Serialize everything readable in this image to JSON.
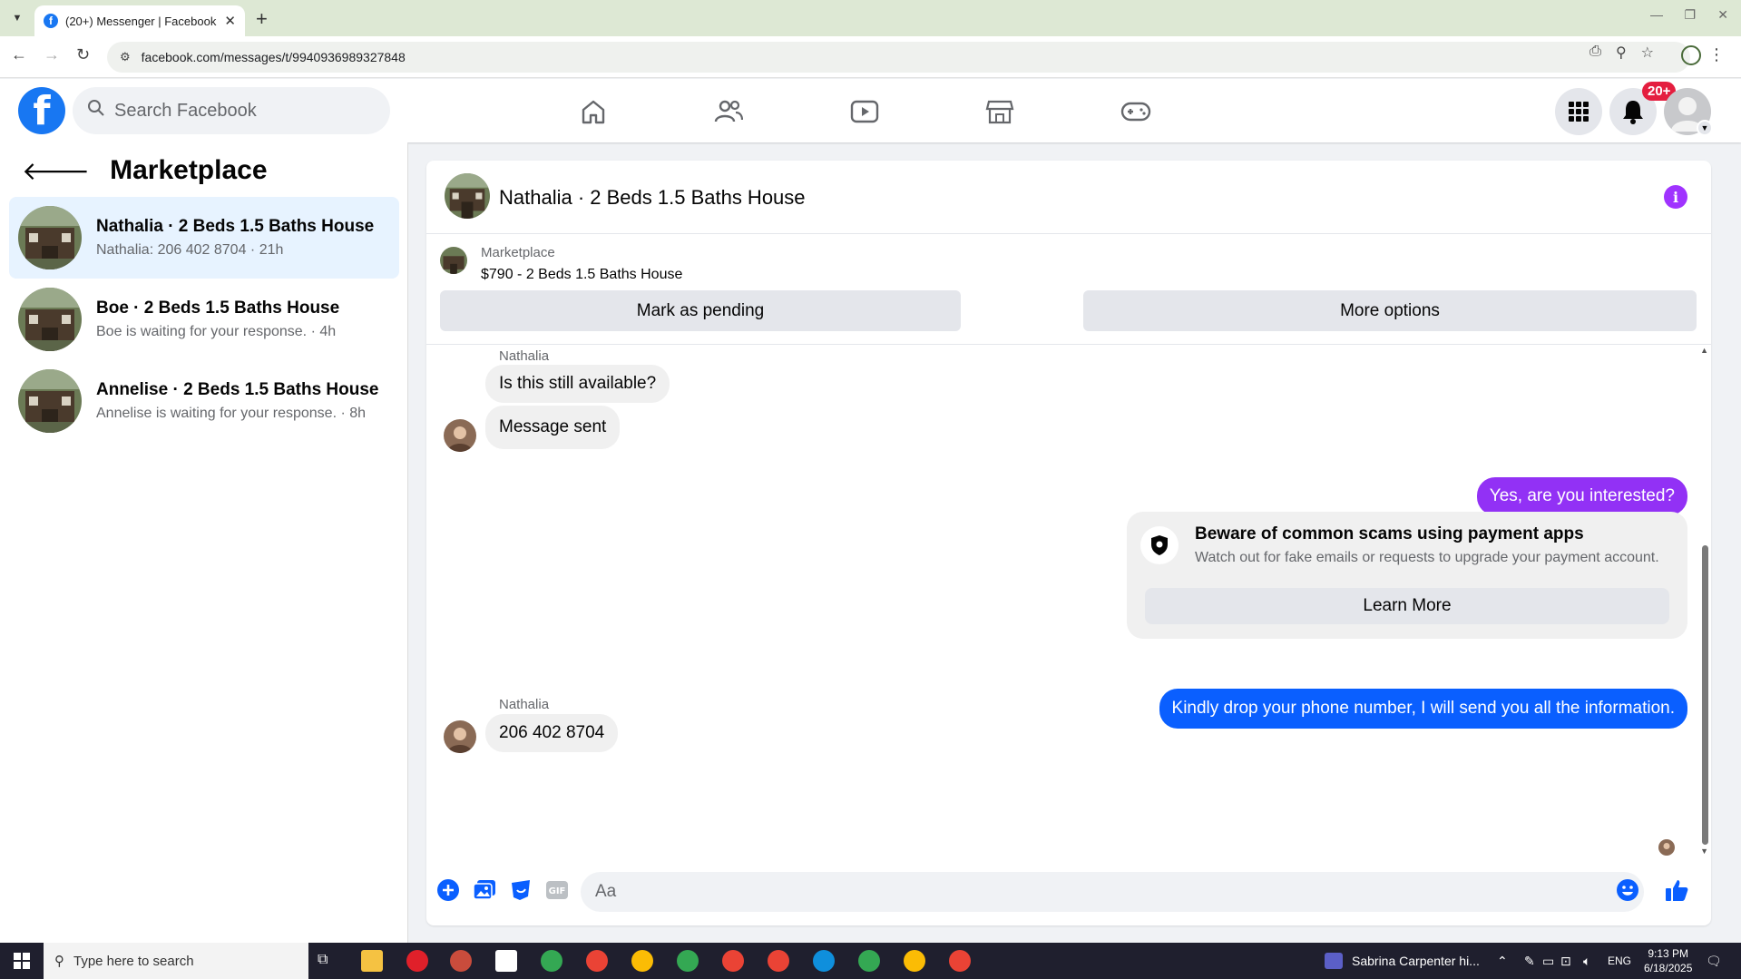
{
  "browser": {
    "tab_title": "(20+) Messenger | Facebook",
    "url": "facebook.com/messages/t/9940936989327848"
  },
  "fb": {
    "search_placeholder": "Search Facebook",
    "notif_badge": "20+",
    "nav_icons": [
      "home-icon",
      "friends-icon",
      "watch-icon",
      "marketplace-icon",
      "gaming-icon"
    ]
  },
  "left": {
    "title": "Marketplace",
    "conversations": [
      {
        "title": "Nathalia · 2 Beds 1.5 Baths House",
        "sub": "Nathalia: 206 402 8704 · 21h"
      },
      {
        "title": "Boe · 2 Beds 1.5 Baths House",
        "sub": "Boe is waiting for your response. · 4h"
      },
      {
        "title": "Annelise · 2 Beds 1.5 Baths House",
        "sub": "Annelise is waiting for your response. · 8h"
      }
    ]
  },
  "chat": {
    "title": "Nathalia · 2 Beds 1.5 Baths House",
    "listing_source": "Marketplace",
    "listing_title": "$790 - 2 Beds 1.5 Baths House",
    "mark_pending": "Mark as pending",
    "more_options": "More options",
    "messages": {
      "sender1": "Nathalia",
      "in1": "Is this still available?",
      "in2": "Message sent",
      "out1": "Yes, are you interested?",
      "scam_title": "Beware of common scams using payment apps",
      "scam_sub": "Watch out for fake emails or requests to upgrade your payment account.",
      "learn_more": "Learn More",
      "out2": "Kindly drop your phone number, I will send you all the information.",
      "sender2": "Nathalia",
      "in3": "206 402 8704"
    },
    "composer_placeholder": "Aa",
    "colors": {
      "purple": "#9231f5",
      "blue": "#0a5fff",
      "fb_blue": "#1877f2"
    }
  },
  "taskbar": {
    "search_placeholder": "Type here to search",
    "media": "Sabrina Carpenter hi...",
    "lang": "ENG",
    "time": "9:13 PM",
    "date": "6/18/2025"
  }
}
